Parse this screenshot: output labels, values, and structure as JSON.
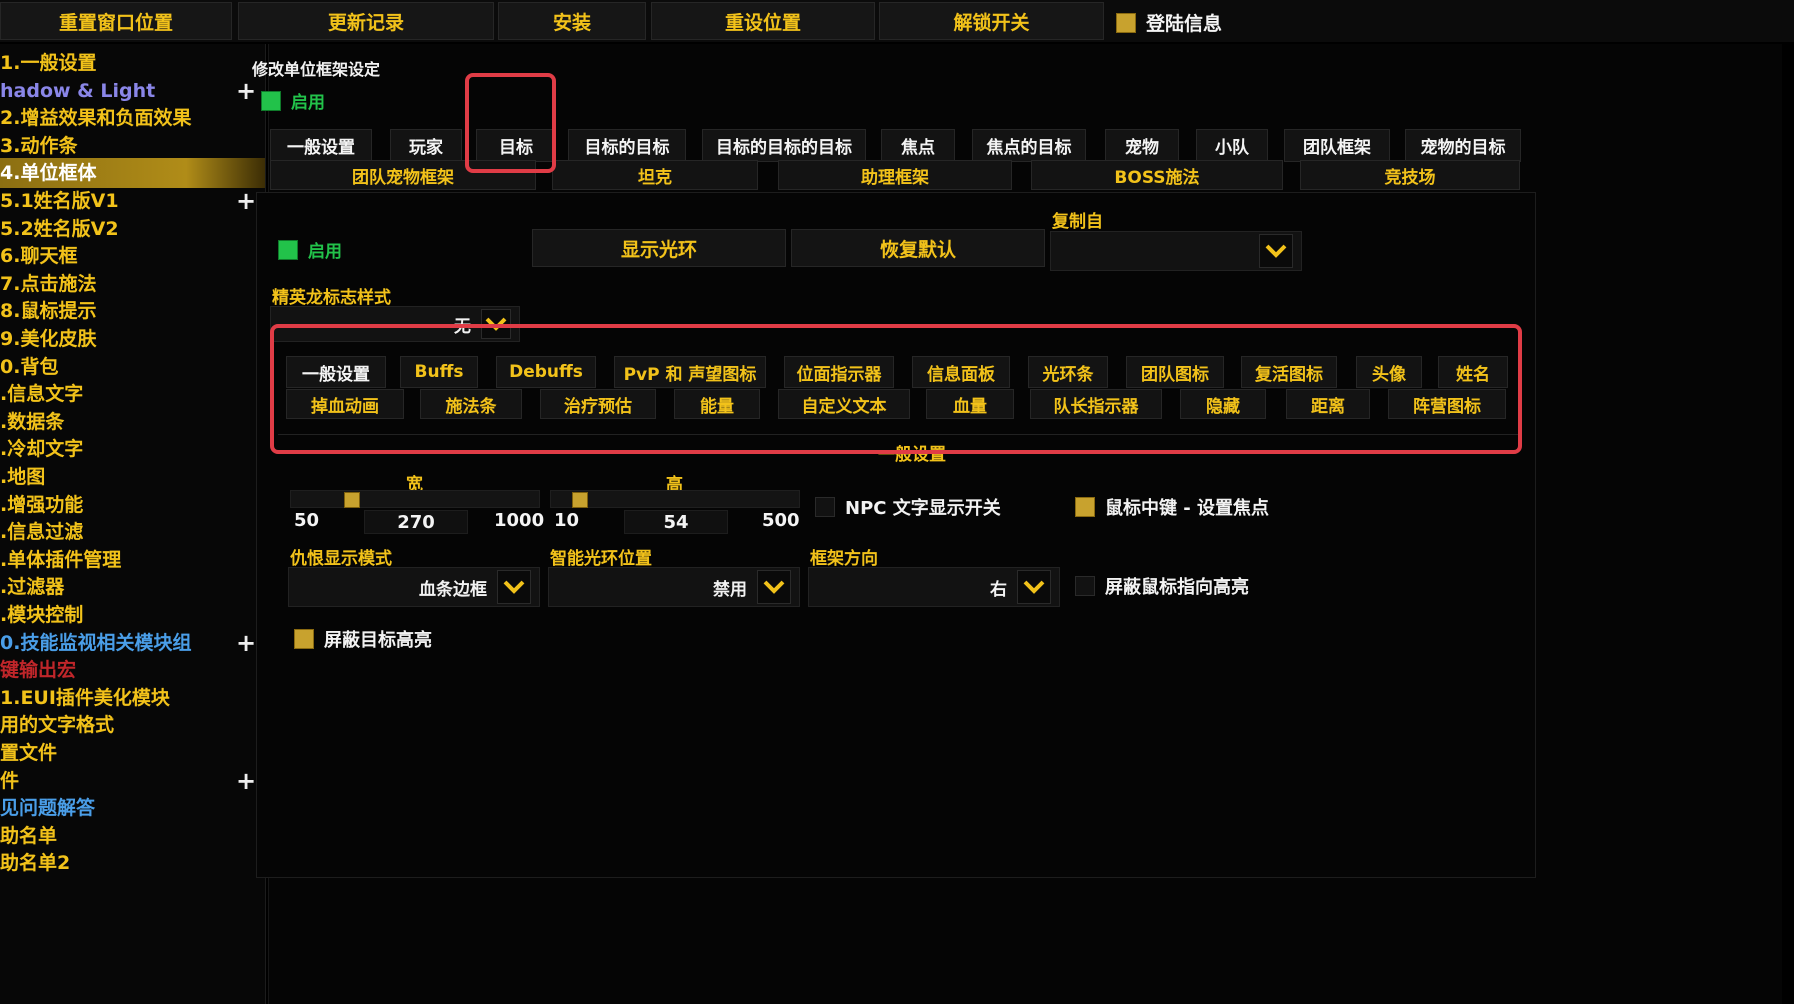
{
  "topbar": {
    "buttons": [
      "重置窗口位置",
      "更新记录",
      "安装",
      "重设位置",
      "解锁开关"
    ],
    "login_label": "登陆信息"
  },
  "sidebar": {
    "items": [
      {
        "label": "1.一般设置",
        "color": "#f2c21a"
      },
      {
        "label": "hadow & Light",
        "color": "#8a86e8"
      },
      {
        "label": "2.增益效果和负面效果",
        "color": "#f2c21a"
      },
      {
        "label": "3.动作条",
        "color": "#f2c21a"
      },
      {
        "label": "4.单位框体",
        "color": "#ffffff"
      },
      {
        "label": "5.1姓名版V1",
        "color": "#f2c21a"
      },
      {
        "label": "5.2姓名版V2",
        "color": "#f2c21a"
      },
      {
        "label": "6.聊天框",
        "color": "#f2c21a"
      },
      {
        "label": "7.点击施法",
        "color": "#f2c21a"
      },
      {
        "label": "8.鼠标提示",
        "color": "#f2c21a"
      },
      {
        "label": "9.美化皮肤",
        "color": "#f2c21a"
      },
      {
        "label": "0.背包",
        "color": "#f2c21a"
      },
      {
        "label": ".信息文字",
        "color": "#f2c21a"
      },
      {
        "label": ".数据条",
        "color": "#f2c21a"
      },
      {
        "label": ".冷却文字",
        "color": "#f2c21a"
      },
      {
        "label": ".地图",
        "color": "#f2c21a"
      },
      {
        "label": ".增强功能",
        "color": "#f2c21a"
      },
      {
        "label": ".信息过滤",
        "color": "#f2c21a"
      },
      {
        "label": ".单体插件管理",
        "color": "#f2c21a"
      },
      {
        "label": ".过滤器",
        "color": "#f2c21a"
      },
      {
        "label": ".模块控制",
        "color": "#f2c21a"
      },
      {
        "label": "0.技能监视相关模块组",
        "color": "#4a9ee8"
      },
      {
        "label": "键输出宏",
        "color": "#c0262a"
      },
      {
        "label": "1.EUI插件美化模块",
        "color": "#f2c21a"
      },
      {
        "label": "用的文字格式",
        "color": "#f2c21a"
      },
      {
        "label": "置文件",
        "color": "#f2c21a"
      },
      {
        "label": "件",
        "color": "#f2c21a"
      },
      {
        "label": "见问题解答",
        "color": "#4a9ee8"
      },
      {
        "label": "助名单",
        "color": "#f2c21a"
      },
      {
        "label": "助名单2",
        "color": "#f2c21a"
      }
    ],
    "plus": "+"
  },
  "main": {
    "section_title": "修改单位框架设定",
    "enable_label": "启用",
    "unit_tabs_row1": [
      "一般设置",
      "玩家",
      "目标",
      "目标的目标",
      "目标的目标的目标",
      "焦点",
      "焦点的目标",
      "宠物",
      "小队",
      "团队框架",
      "宠物的目标"
    ],
    "unit_tabs_row2": [
      "团队宠物框架",
      "坦克",
      "助理框架",
      "BOSS施法",
      "竞技场"
    ],
    "copy_from_label": "复制自",
    "enable2_label": "启用",
    "show_aura_btn": "显示光环",
    "restore_default_btn": "恢复默认",
    "copy_from_value": "",
    "elite_style_label": "精英龙标志样式",
    "elite_style_value": "无",
    "sub_tabs_row1": [
      "一般设置",
      "Buffs",
      "Debuffs",
      "PvP 和 声望图标",
      "位面指示器",
      "信息面板",
      "光环条",
      "团队图标",
      "复活图标",
      "头像",
      "姓名"
    ],
    "sub_tabs_row2": [
      "掉血动画",
      "施法条",
      "治疗预估",
      "能量",
      "自定义文本",
      "血量",
      "队长指示器",
      "隐藏",
      "距离",
      "阵营图标"
    ],
    "general_header": "一般设置",
    "width": {
      "label": "宽",
      "min": "50",
      "value": "270",
      "max": "1000",
      "fraction": 0.23
    },
    "height": {
      "label": "高",
      "min": "10",
      "value": "54",
      "max": "500",
      "fraction": 0.09
    },
    "npc_text_toggle": "NPC 文字显示开关",
    "middle_click_focus": "鼠标中键 - 设置焦点",
    "threat_mode_label": "仇恨显示模式",
    "threat_mode_value": "血条边框",
    "smart_aura_label": "智能光环位置",
    "smart_aura_value": "禁用",
    "frame_orientation_label": "框架方向",
    "frame_orientation_value": "右",
    "disable_mouseover_highlight": "屏蔽鼠标指向高亮",
    "disable_target_highlight": "屏蔽目标高亮"
  },
  "colors": {
    "accent": "#f2c21a",
    "highlight": "#e03c46",
    "enabled": "#22c24a"
  }
}
